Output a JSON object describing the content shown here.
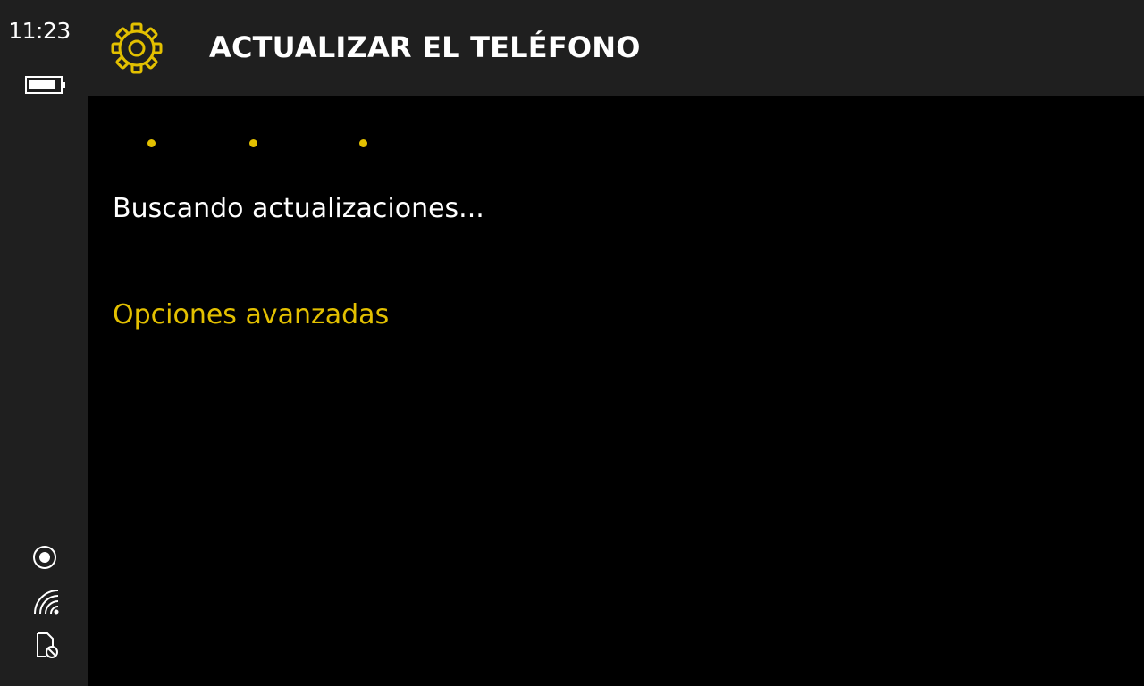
{
  "status_bar": {
    "time": "11:23",
    "icons": [
      "battery-icon",
      "location-icon",
      "wifi-icon",
      "sim-blocked-icon"
    ]
  },
  "header": {
    "title": "ACTUALIZAR EL TELÉFONO",
    "icon": "gear-icon"
  },
  "content": {
    "progress_dots": 3,
    "status_text": "Buscando actualizaciones...",
    "advanced_link": "Opciones avanzadas"
  },
  "colors": {
    "accent": "#e3c000",
    "chrome": "#1f1f1f",
    "background": "#000000",
    "text": "#ffffff"
  }
}
